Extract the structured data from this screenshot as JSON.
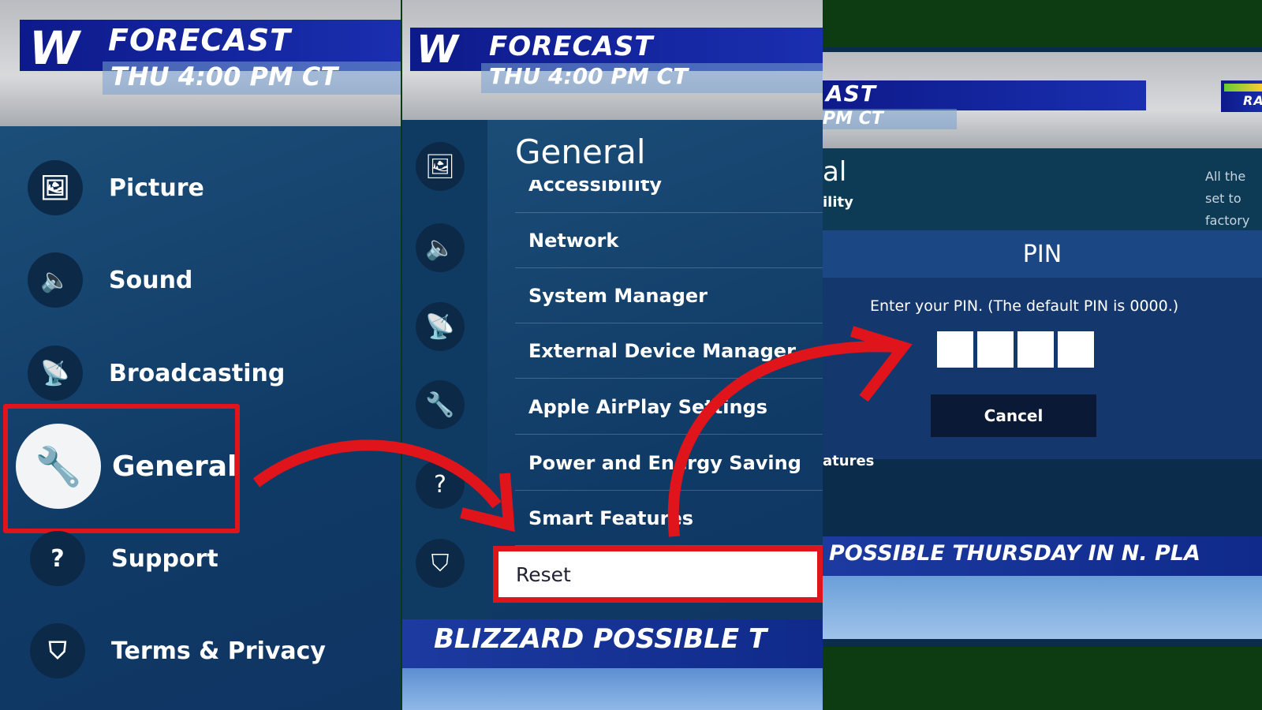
{
  "panel1": {
    "logo": "W",
    "banner_title": "FORECAST",
    "banner_time": "THU 4:00 PM CT",
    "menu": [
      {
        "label": "Picture",
        "icon": "picture-icon"
      },
      {
        "label": "Sound",
        "icon": "speaker-icon"
      },
      {
        "label": "Broadcasting",
        "icon": "satellite-icon"
      },
      {
        "label": "General",
        "icon": "wrench-icon",
        "selected": true
      },
      {
        "label": "Support",
        "icon": "support-cloud-icon"
      },
      {
        "label": "Terms & Privacy",
        "icon": "shield-icon"
      }
    ]
  },
  "panel2": {
    "logo": "W",
    "banner_title": "FORECAST",
    "banner_time": "THU 4:00 PM CT",
    "title": "General",
    "items": [
      "Accessibility",
      "Network",
      "System Manager",
      "External Device Manager",
      "Apple AirPlay Settings",
      "Power and Energy Saving",
      "Smart Features",
      "Reset"
    ],
    "selected": "Reset",
    "ticker": "BLIZZARD POSSIBLE T"
  },
  "panel3": {
    "banner_title": "AST",
    "banner_time": "PM CT",
    "radar_label": "RA",
    "bg_title": "al",
    "bg_item": "ility",
    "bg_item2": "atures",
    "desc": "All the set to factory",
    "dialog_title": "PIN",
    "prompt": "Enter your PIN. (The default PIN is 0000.)",
    "cancel": "Cancel",
    "ticker": "POSSIBLE THURSDAY IN N. PLA"
  },
  "colors": {
    "highlight": "#e0141b",
    "menu_bg": "#103a66",
    "banner": "#0d1a8a"
  }
}
